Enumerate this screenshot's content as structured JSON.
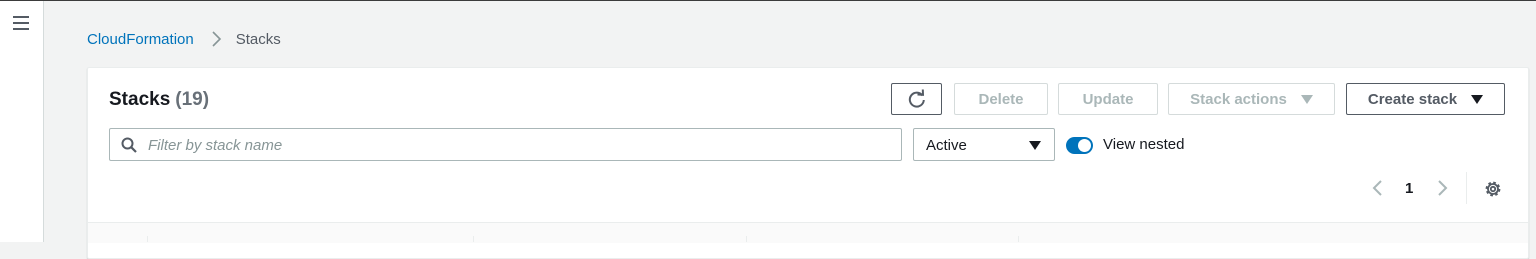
{
  "breadcrumb": {
    "root": "CloudFormation",
    "current": "Stacks"
  },
  "panel": {
    "title": "Stacks",
    "count": "(19)"
  },
  "toolbar": {
    "refresh_icon": "refresh-icon",
    "delete_label": "Delete",
    "update_label": "Update",
    "stack_actions_label": "Stack actions",
    "create_stack_label": "Create stack"
  },
  "filter": {
    "placeholder": "Filter by stack name",
    "value": ""
  },
  "status_select": {
    "value": "Active"
  },
  "view_nested": {
    "label": "View nested",
    "on": true
  },
  "pagination": {
    "current_page": "1"
  },
  "colors": {
    "link": "#0073bb",
    "toggle_on": "#0073bb",
    "disabled_text": "#aab7b8",
    "page_bg": "#f2f3f3"
  }
}
